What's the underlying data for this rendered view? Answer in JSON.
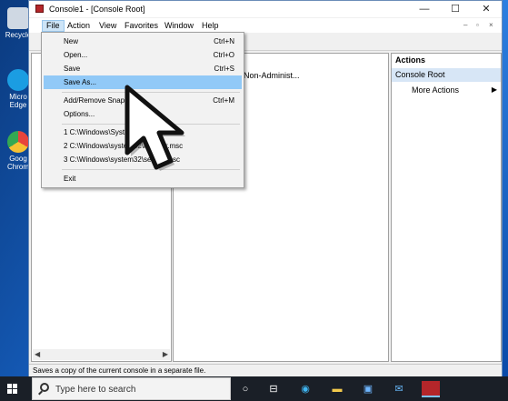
{
  "desktop": {
    "icons": [
      {
        "label": "Recycle",
        "color": "#cfd8e3"
      },
      {
        "label": "Micro Edge",
        "color": "#1b9de2"
      },
      {
        "label": "Goog Chrom",
        "color": "#e8453c"
      }
    ]
  },
  "window": {
    "title": "Console1 - [Console Root]",
    "controls": {
      "minimize": "—",
      "maximize": "☐",
      "close": "✕"
    },
    "mdi_controls": {
      "minimize": "–",
      "restore": "▫",
      "close": "×"
    }
  },
  "menubar": {
    "items": [
      "File",
      "Action",
      "View",
      "Favorites",
      "Window",
      "Help"
    ],
    "active": "File"
  },
  "file_menu": {
    "items": [
      {
        "label": "New",
        "shortcut": "Ctrl+N"
      },
      {
        "label": "Open...",
        "shortcut": "Ctrl+O"
      },
      {
        "label": "Save",
        "shortcut": "Ctrl+S"
      },
      {
        "label": "Save As...",
        "shortcut": ""
      },
      {
        "label": "Add/Remove Snap-in...",
        "shortcut": "Ctrl+M"
      },
      {
        "label": "Options...",
        "shortcut": ""
      },
      {
        "label": "1 C:\\Windows\\System32\\gpedit.msc",
        "shortcut": ""
      },
      {
        "label": "2 C:\\Windows\\system32\\lusrmgr.msc",
        "shortcut": ""
      },
      {
        "label": "3 C:\\Windows\\system32\\secpol.msc",
        "shortcut": ""
      },
      {
        "label": "Exit",
        "shortcut": ""
      }
    ],
    "highlighted_index": 3
  },
  "center_pane": {
    "text": "Non-Administ..."
  },
  "actions_pane": {
    "title": "Actions",
    "section": "Console Root",
    "item": "More Actions",
    "item_arrow": "▶"
  },
  "status_bar": {
    "text": "Saves a copy of the current console in a separate file."
  },
  "taskbar": {
    "search_placeholder": "Type here to search",
    "icons": [
      "task-view-icon",
      "widgets-icon",
      "edge-icon",
      "file-explorer-icon",
      "store-icon",
      "mail-icon",
      "mmc-icon"
    ]
  },
  "colors": {
    "menu_highlight": "#91c9f7",
    "actions_section_bg": "#d7e6f6",
    "taskbar_bg": "#1a1f27"
  }
}
